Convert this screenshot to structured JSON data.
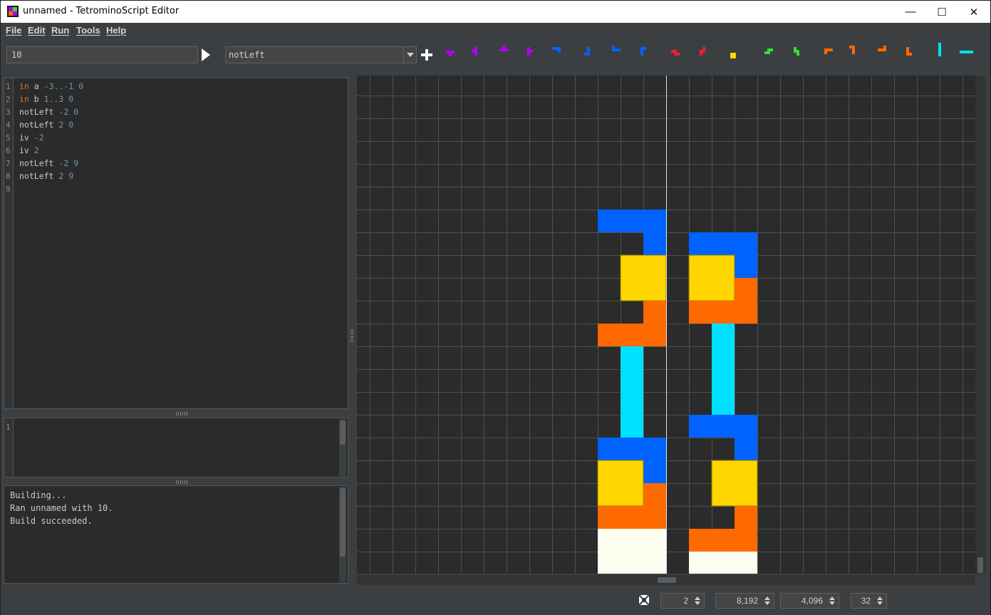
{
  "window": {
    "title": "unnamed - TetrominoScript Editor",
    "controls": {
      "minimize": "—",
      "maximize": "☐",
      "close": "✕"
    }
  },
  "menu": [
    "File",
    "Edit",
    "Run",
    "Tools",
    "Help"
  ],
  "toolbar": {
    "argument_value": "10",
    "function_selected": "notLeft"
  },
  "tetromino_palette": [
    {
      "name": "t-down",
      "color": "#b000ff"
    },
    {
      "name": "t-left",
      "color": "#b000ff"
    },
    {
      "name": "t-up",
      "color": "#b000ff"
    },
    {
      "name": "t-right",
      "color": "#b000ff"
    },
    {
      "name": "j-down",
      "color": "#0063ff"
    },
    {
      "name": "j-left",
      "color": "#0063ff"
    },
    {
      "name": "j-up",
      "color": "#0063ff"
    },
    {
      "name": "j-right",
      "color": "#0063ff"
    },
    {
      "name": "z-horizontal",
      "color": "#ff1a2e"
    },
    {
      "name": "z-vertical",
      "color": "#ff1a2e"
    },
    {
      "name": "o",
      "color": "#ffd600"
    },
    {
      "name": "s-horizontal",
      "color": "#36e12b"
    },
    {
      "name": "s-vertical",
      "color": "#36e12b"
    },
    {
      "name": "l-down",
      "color": "#ff6a00"
    },
    {
      "name": "l-left",
      "color": "#ff6a00"
    },
    {
      "name": "l-up",
      "color": "#ff6a00"
    },
    {
      "name": "l-right",
      "color": "#ff6a00"
    },
    {
      "name": "i-vertical",
      "color": "#00e0ff"
    },
    {
      "name": "i-horizontal",
      "color": "#00e0ff"
    }
  ],
  "editor": {
    "lines": [
      {
        "n": "1",
        "tokens": [
          {
            "t": "in",
            "c": "kw"
          },
          {
            "t": " a ",
            "c": ""
          },
          {
            "t": "-3..-1 0",
            "c": "num"
          }
        ]
      },
      {
        "n": "2",
        "tokens": [
          {
            "t": "in",
            "c": "kw"
          },
          {
            "t": " b ",
            "c": ""
          },
          {
            "t": "1..3 0",
            "c": "num"
          }
        ]
      },
      {
        "n": "3",
        "tokens": [
          {
            "t": "notLeft ",
            "c": ""
          },
          {
            "t": "-2 0",
            "c": "num"
          }
        ]
      },
      {
        "n": "4",
        "tokens": [
          {
            "t": "notLeft ",
            "c": ""
          },
          {
            "t": "2 0",
            "c": "num"
          }
        ]
      },
      {
        "n": "5",
        "tokens": [
          {
            "t": "iv ",
            "c": ""
          },
          {
            "t": "-2",
            "c": "num"
          }
        ]
      },
      {
        "n": "6",
        "tokens": [
          {
            "t": "iv ",
            "c": ""
          },
          {
            "t": "2",
            "c": "num"
          }
        ]
      },
      {
        "n": "7",
        "tokens": [
          {
            "t": "notLeft ",
            "c": ""
          },
          {
            "t": "-2 9",
            "c": "num"
          }
        ]
      },
      {
        "n": "8",
        "tokens": [
          {
            "t": "notLeft ",
            "c": ""
          },
          {
            "t": "2 9",
            "c": "num"
          }
        ]
      },
      {
        "n": "9",
        "tokens": []
      }
    ]
  },
  "console_input": {
    "line_numbers": [
      "1"
    ]
  },
  "output": {
    "lines": [
      "Building...",
      "Ran unnamed with 10.",
      "Build succeeded."
    ]
  },
  "playfield": {
    "colors": {
      "blue": "#0063ff",
      "yellow": "#ffd600",
      "orange": "#ff6a00",
      "cyan": "#00e0ff",
      "white": "#fdfdf0",
      "grid": "#4f4f4f",
      "origin_line": "#e0e0e0"
    }
  },
  "statusbar": {
    "spinners": [
      {
        "name": "scale-spinner",
        "value": "2"
      },
      {
        "name": "width-spinner",
        "value": "8,192"
      },
      {
        "name": "height-spinner",
        "value": "4,096"
      },
      {
        "name": "frame-rate-spinner",
        "value": "32"
      }
    ]
  }
}
